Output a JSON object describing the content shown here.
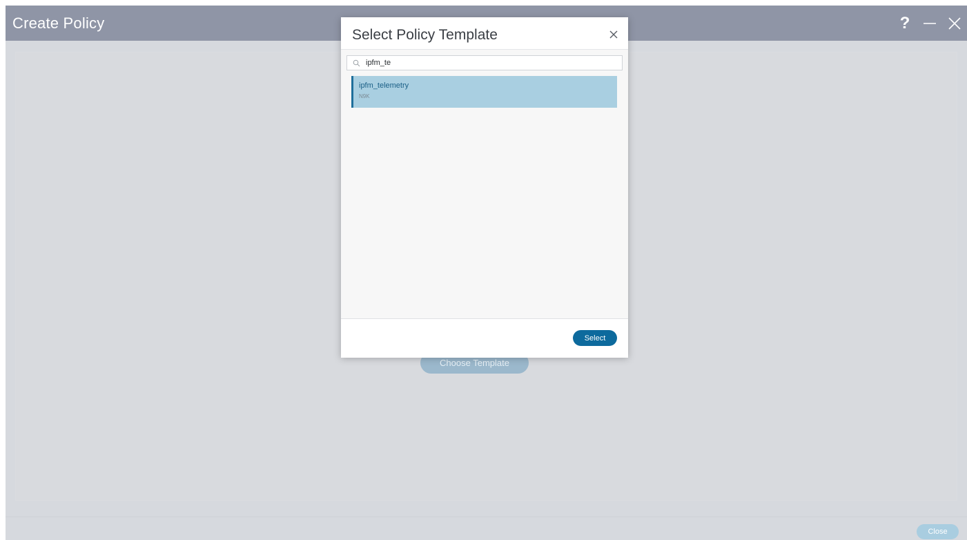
{
  "window": {
    "title": "Create Policy",
    "help_label": "?",
    "controls": [
      "help-icon",
      "minimize-icon",
      "close-icon"
    ]
  },
  "main": {
    "choose_template_label": "Choose Template",
    "close_label": "Close"
  },
  "modal": {
    "title": "Select Policy Template",
    "search": {
      "value": "ipfm_te",
      "icon": "search-icon"
    },
    "results": [
      {
        "name": "ipfm_telemetry",
        "platform": "N9K",
        "selected": true
      }
    ],
    "select_label": "Select"
  },
  "colors": {
    "titlebar": "#8f95a6",
    "accent": "#0d6a9d",
    "selected_row": "#a9cfe1",
    "selected_row_border": "#1f6f9b"
  }
}
